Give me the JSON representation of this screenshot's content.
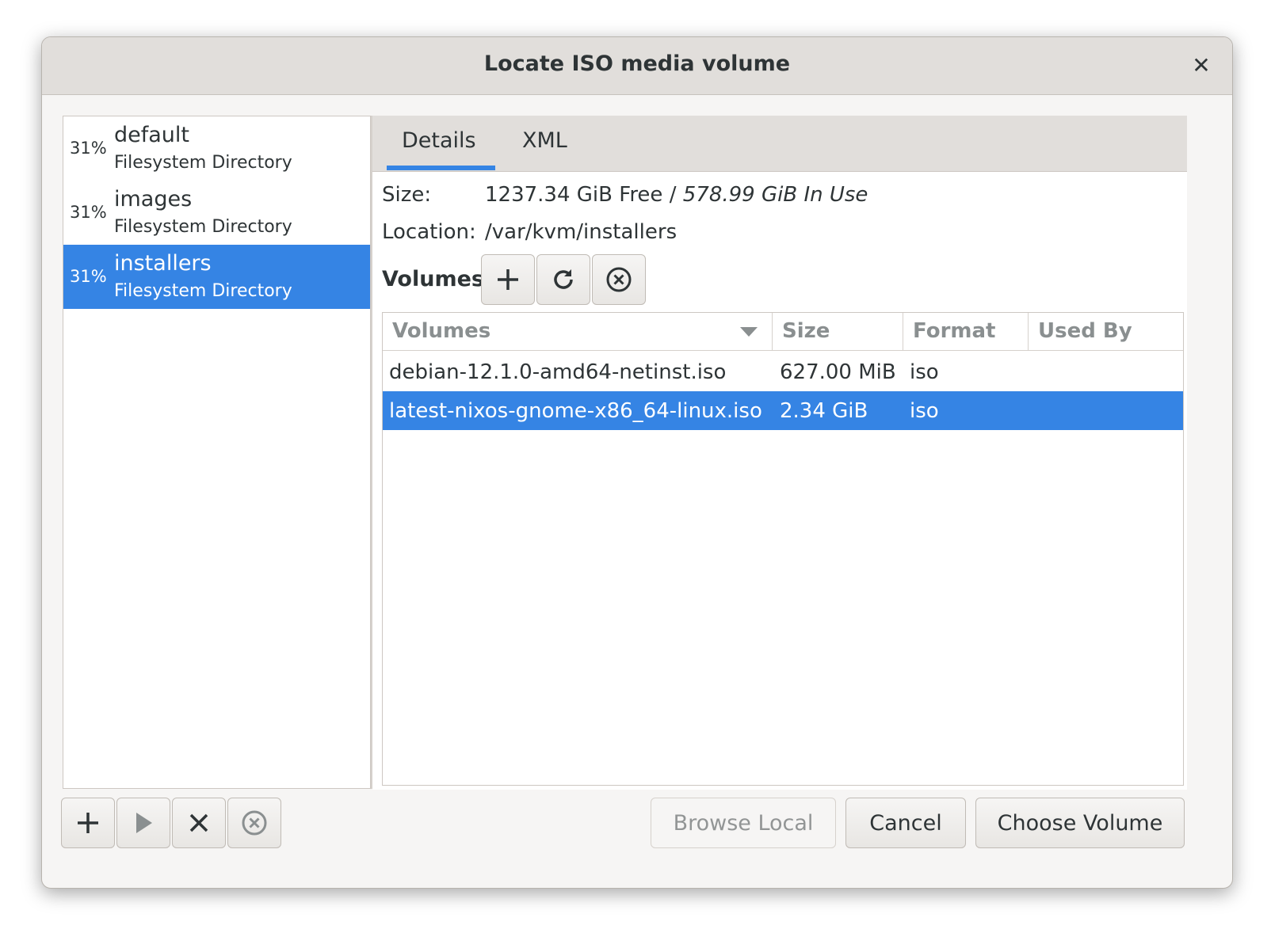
{
  "window": {
    "title": "Locate ISO media volume"
  },
  "pools": [
    {
      "percent": "31%",
      "name": "default",
      "type": "Filesystem Directory",
      "selected": false
    },
    {
      "percent": "31%",
      "name": "images",
      "type": "Filesystem Directory",
      "selected": false
    },
    {
      "percent": "31%",
      "name": "installers",
      "type": "Filesystem Directory",
      "selected": true
    }
  ],
  "tabs": [
    {
      "label": "Details",
      "active": true
    },
    {
      "label": "XML",
      "active": false
    }
  ],
  "details": {
    "size_label": "Size:",
    "size_free": "1237.34 GiB Free",
    "size_sep": " / ",
    "size_used": "578.99 GiB In Use",
    "location_label": "Location:",
    "location_value": "/var/kvm/installers",
    "volumes_heading": "Volumes"
  },
  "volume_toolbar": [
    "add-icon",
    "refresh-icon",
    "stop-icon"
  ],
  "table": {
    "columns": [
      "Volumes",
      "Size",
      "Format",
      "Used By"
    ],
    "rows": [
      {
        "name": "debian-12.1.0-amd64-netinst.iso",
        "size": "627.00 MiB",
        "format": "iso",
        "used_by": "",
        "selected": false
      },
      {
        "name": "latest-nixos-gnome-x86_64-linux.iso",
        "size": "2.34 GiB",
        "format": "iso",
        "used_by": "",
        "selected": true
      }
    ]
  },
  "pool_toolbar": [
    "add-icon",
    "play-icon",
    "delete-icon",
    "stop-icon"
  ],
  "buttons": {
    "browse_local": "Browse Local",
    "cancel": "Cancel",
    "choose_volume": "Choose Volume"
  },
  "colors": {
    "accent": "#3584e4",
    "titlebar": "#e1dedb",
    "window_bg": "#f6f5f4"
  }
}
